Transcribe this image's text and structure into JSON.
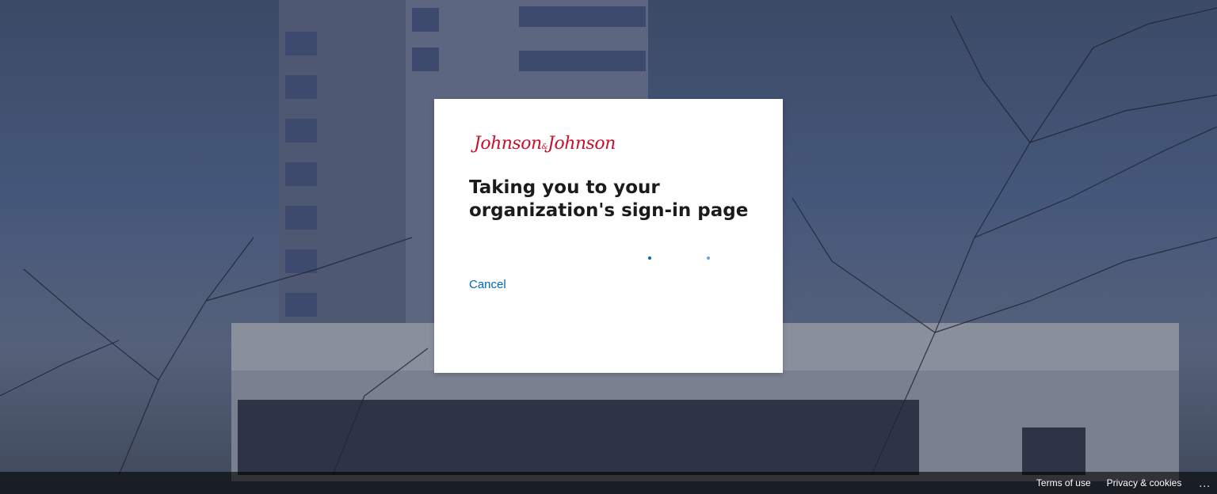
{
  "brand": {
    "logo_left": "Johnson",
    "logo_amp": "&",
    "logo_right": "Johnson",
    "logo_color": "#c8102e"
  },
  "dialog": {
    "title": "Taking you to your organization's sign-in page",
    "cancel_label": "Cancel",
    "accent_color": "#0067b8"
  },
  "footer": {
    "terms_label": "Terms of use",
    "privacy_label": "Privacy & cookies",
    "more_label": "..."
  },
  "icons": {
    "loading": "progress-dots-icon",
    "more": "ellipsis-icon"
  }
}
